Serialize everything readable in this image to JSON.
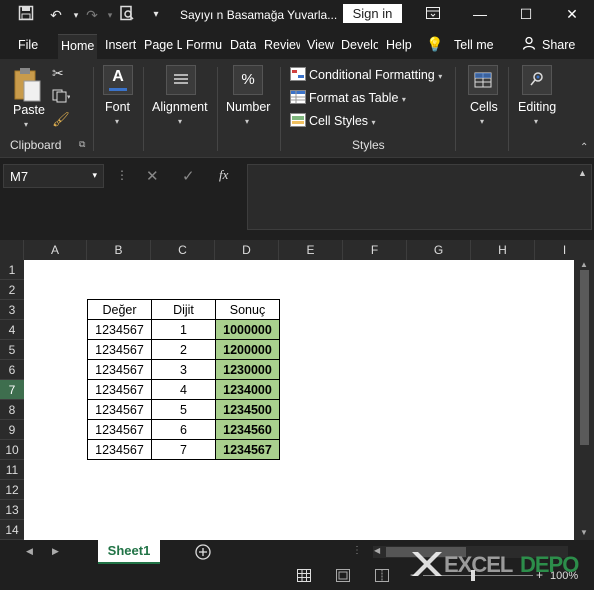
{
  "title": "Sayıyı n Basamağa Yuvarla...",
  "signin_label": "Sign in",
  "tabs": [
    "File",
    "Home",
    "Insert",
    "Page L",
    "Formu",
    "Data",
    "Review",
    "View",
    "Develo",
    "Help"
  ],
  "tell_me": "Tell me",
  "share": "Share",
  "ribbon": {
    "paste": "Paste",
    "clipboard": "Clipboard",
    "font": "Font",
    "alignment": "Alignment",
    "number": "Number",
    "conditional_formatting": "Conditional Formatting",
    "format_as_table": "Format as Table",
    "cell_styles": "Cell Styles",
    "styles": "Styles",
    "cells": "Cells",
    "editing": "Editing"
  },
  "name_box": "M7",
  "fx": "fx",
  "columns": [
    "A",
    "B",
    "C",
    "D",
    "E",
    "F",
    "G",
    "H",
    "I"
  ],
  "rows": [
    "1",
    "2",
    "3",
    "4",
    "5",
    "6",
    "7",
    "8",
    "9",
    "10",
    "11",
    "12",
    "13",
    "14"
  ],
  "selected_row": "7",
  "table": {
    "headers": [
      "Değer",
      "Dijit",
      "Sonuç"
    ],
    "rows": [
      [
        "1234567",
        "1",
        "1000000"
      ],
      [
        "1234567",
        "2",
        "1200000"
      ],
      [
        "1234567",
        "3",
        "1230000"
      ],
      [
        "1234567",
        "4",
        "1234000"
      ],
      [
        "1234567",
        "5",
        "1234500"
      ],
      [
        "1234567",
        "6",
        "1234560"
      ],
      [
        "1234567",
        "7",
        "1234567"
      ]
    ]
  },
  "sheet_tab": "Sheet1",
  "zoom": "100%",
  "watermark": "EXCELDEPO",
  "colors": {
    "result_fill": "#a9d08e",
    "accent": "#217346",
    "selected_row": "#3e6e4e"
  }
}
